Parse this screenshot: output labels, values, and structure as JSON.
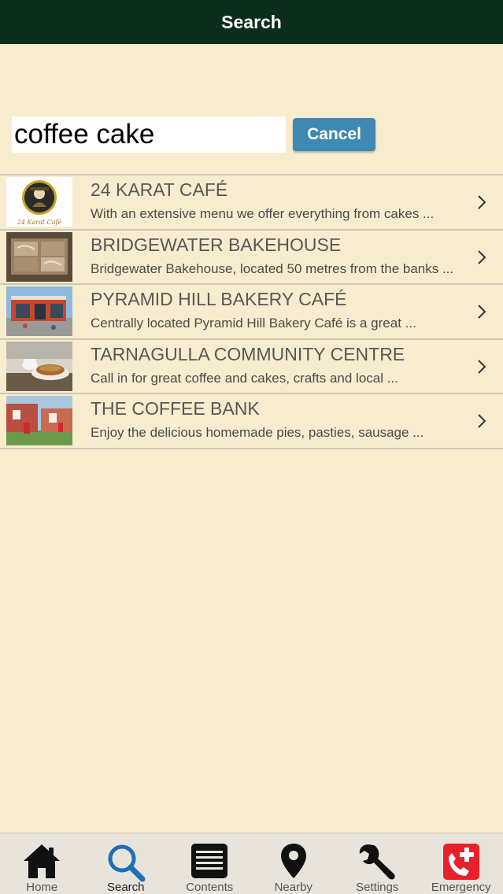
{
  "header": {
    "title": "Search"
  },
  "search": {
    "value": "coffee cake",
    "cancel_label": "Cancel"
  },
  "results": [
    {
      "title": "24 KARAT CAFÉ",
      "description": "With an extensive menu we offer everything from cakes ..."
    },
    {
      "title": "BRIDGEWATER BAKEHOUSE",
      "description": "Bridgewater Bakehouse, located 50 metres from the banks ..."
    },
    {
      "title": "PYRAMID HILL BAKERY CAFÉ",
      "description": "Centrally located Pyramid Hill Bakery Café is a great ..."
    },
    {
      "title": "TARNAGULLA COMMUNITY CENTRE",
      "description": "Call in for great coffee and cakes, crafts and local ..."
    },
    {
      "title": "THE COFFEE BANK",
      "description": "Enjoy the delicious homemade pies, pasties, sausage ..."
    }
  ],
  "thumb_text": {
    "logo": "24 Karat Café"
  },
  "tabs": [
    {
      "label": "Home",
      "icon": "house-icon"
    },
    {
      "label": "Search",
      "icon": "magnifier-icon",
      "active": true
    },
    {
      "label": "Contents",
      "icon": "list-icon"
    },
    {
      "label": "Nearby",
      "icon": "map-pin-icon"
    },
    {
      "label": "Settings",
      "icon": "wrench-icon"
    },
    {
      "label": "Emergency",
      "icon": "emergency-phone-icon"
    }
  ],
  "colors": {
    "nav_bar": "#0b2d1c",
    "background": "#f8ecce",
    "cancel_button": "#3f8ab3",
    "active_tab": "#1f6fb5",
    "emergency": "#e8202a"
  }
}
